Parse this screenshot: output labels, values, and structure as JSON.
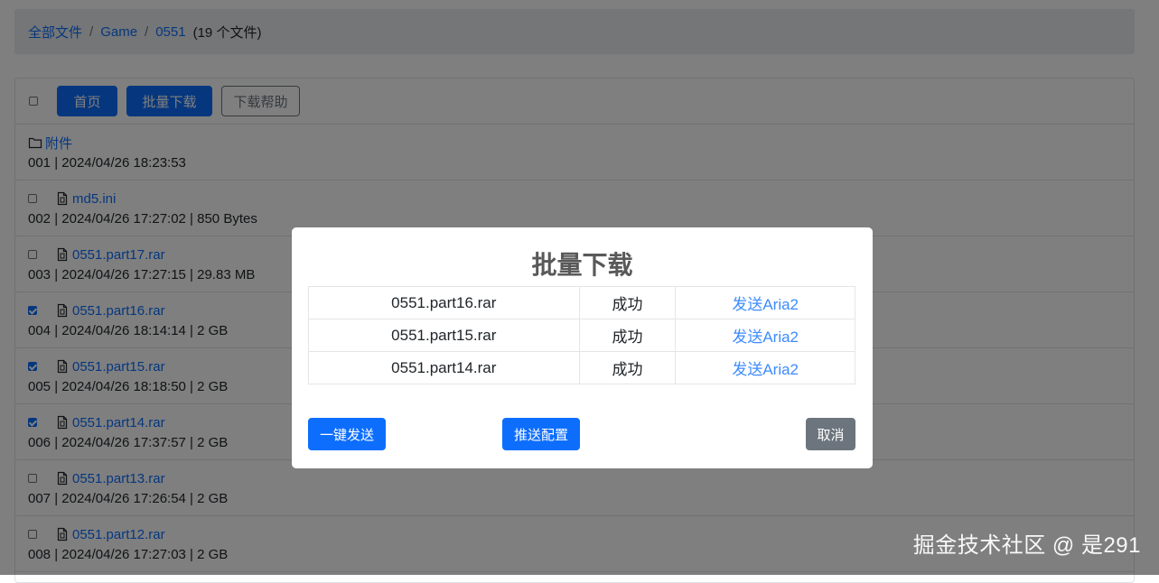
{
  "breadcrumb": {
    "items": [
      "全部文件",
      "Game",
      "0551"
    ],
    "separator": "/",
    "count": "(19 个文件)"
  },
  "toolbar": {
    "home_label": "首页",
    "batch_label": "批量下载",
    "help_label": "下载帮助"
  },
  "files": [
    {
      "type": "folder",
      "name": "附件",
      "meta": "001 | 2024/04/26 18:23:53",
      "checkbox": false,
      "checked": false
    },
    {
      "type": "file",
      "name": "md5.ini",
      "meta": "002 | 2024/04/26 17:27:02 | 850 Bytes",
      "checkbox": true,
      "checked": false
    },
    {
      "type": "file",
      "name": "0551.part17.rar",
      "meta": "003 | 2024/04/26 17:27:15 | 29.83 MB",
      "checkbox": true,
      "checked": false
    },
    {
      "type": "file",
      "name": "0551.part16.rar",
      "meta": "004 | 2024/04/26 18:14:14 | 2 GB",
      "checkbox": true,
      "checked": true
    },
    {
      "type": "file",
      "name": "0551.part15.rar",
      "meta": "005 | 2024/04/26 18:18:50 | 2 GB",
      "checkbox": true,
      "checked": true
    },
    {
      "type": "file",
      "name": "0551.part14.rar",
      "meta": "006 | 2024/04/26 17:37:57 | 2 GB",
      "checkbox": true,
      "checked": true
    },
    {
      "type": "file",
      "name": "0551.part13.rar",
      "meta": "007 | 2024/04/26 17:26:54 | 2 GB",
      "checkbox": true,
      "checked": false
    },
    {
      "type": "file",
      "name": "0551.part12.rar",
      "meta": "008 | 2024/04/26 17:27:03 | 2 GB",
      "checkbox": true,
      "checked": false
    }
  ],
  "modal": {
    "title": "批量下载",
    "rows": [
      {
        "name": "0551.part16.rar",
        "status": "成功",
        "action": "发送Aria2"
      },
      {
        "name": "0551.part15.rar",
        "status": "成功",
        "action": "发送Aria2"
      },
      {
        "name": "0551.part14.rar",
        "status": "成功",
        "action": "发送Aria2"
      }
    ],
    "send_all_label": "一键发送",
    "push_config_label": "推送配置",
    "cancel_label": "取消"
  },
  "watermark": "掘金技术社区 @ 是291",
  "colors": {
    "primary": "#0d6efd",
    "secondary": "#6c757d",
    "link": "#3d8bfd",
    "breadcrumb_bg": "#e9ecef"
  }
}
